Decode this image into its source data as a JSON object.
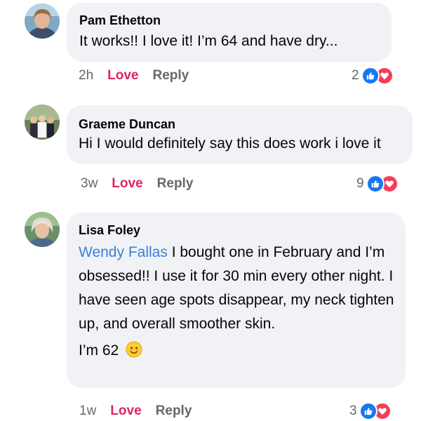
{
  "comments": [
    {
      "author": "Pam Ethetton",
      "text": "It works!! I love it! I’m 64 and have dry...",
      "time": "2h",
      "love_label": "Love",
      "reply_label": "Reply",
      "reaction_count": "2"
    },
    {
      "author": "Graeme Duncan",
      "text": "Hi I would definitely say this does work i love it",
      "time": "3w",
      "love_label": "Love",
      "reply_label": "Reply",
      "reaction_count": "9"
    },
    {
      "author": "Lisa Foley",
      "mention": "Wendy Fallas",
      "text": "I bought one in February and I’m obsessed!! I use it for 30 min every other night.  I have seen age spots disappear, my neck tighten up, and overall smoother skin.",
      "text2": "I’m 62",
      "time": "1w",
      "love_label": "Love",
      "reply_label": "Reply",
      "reaction_count": "3"
    }
  ],
  "icons": {
    "like": "thumbs-up-icon",
    "love": "heart-icon",
    "emoji": "smiling-face-icon"
  },
  "colors": {
    "bubble": "#f0f2f5",
    "love_action": "#e0245e",
    "like_reaction": "#1877f2",
    "love_reaction": "#f33e58",
    "mention": "#3b82d6"
  }
}
